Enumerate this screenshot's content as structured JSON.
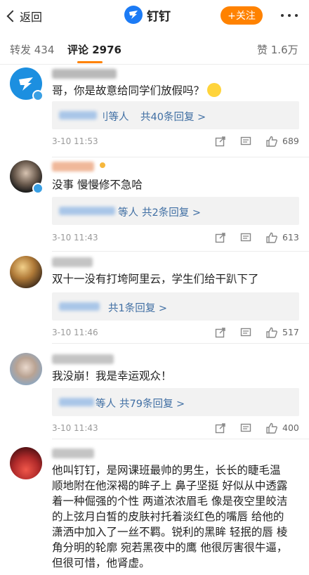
{
  "nav": {
    "back_label": "返回",
    "title": "钉钉",
    "follow_label": "+关注"
  },
  "tabs": {
    "repost": "转发 434",
    "comments": "评论 2976",
    "likes": "赞 1.6万"
  },
  "comments": [
    {
      "text": "哥，你是故意给同学们放假吗？",
      "reply_tail": "刂等人",
      "reply_count": "共40条回复 >",
      "time": "3-10 11:53",
      "likes": "689"
    },
    {
      "text": "没事 慢慢修不急哈",
      "reply_tail": "等人",
      "reply_count": "共2条回复 >",
      "time": "3-10 11:43",
      "likes": "613"
    },
    {
      "text": "双十一没有打垮阿里云，学生们给干趴下了",
      "reply_tail": "",
      "reply_count": "共1条回复 >",
      "time": "3-10 11:46",
      "likes": "517"
    },
    {
      "text": "我没崩！我是幸运观众！",
      "reply_tail": "等人",
      "reply_count": "共79条回复 >",
      "time": "3-10 11:43",
      "likes": "400"
    },
    {
      "lines": [
        "他叫钉钉，是网课班最帅的男生，长长的睫毛温",
        "顺地附在他深褐的眸子上 鼻子坚挺 好似从中透露",
        "着一种倔强的个性 两道浓浓眉毛 像是夜空里皎洁",
        "的上弦月白皙的皮肤衬托着淡红色的嘴唇 给他的",
        "潇洒中加入了一丝不羁。锐利的黑眸 轻抿的唇 棱",
        "角分明的轮廓 宛若黑夜中的鹰 他很厉害很牛逼，",
        "但很可惜，他肾虚。"
      ]
    }
  ],
  "colors": {
    "accent": "#ff8200",
    "link": "#3f6ea3"
  }
}
